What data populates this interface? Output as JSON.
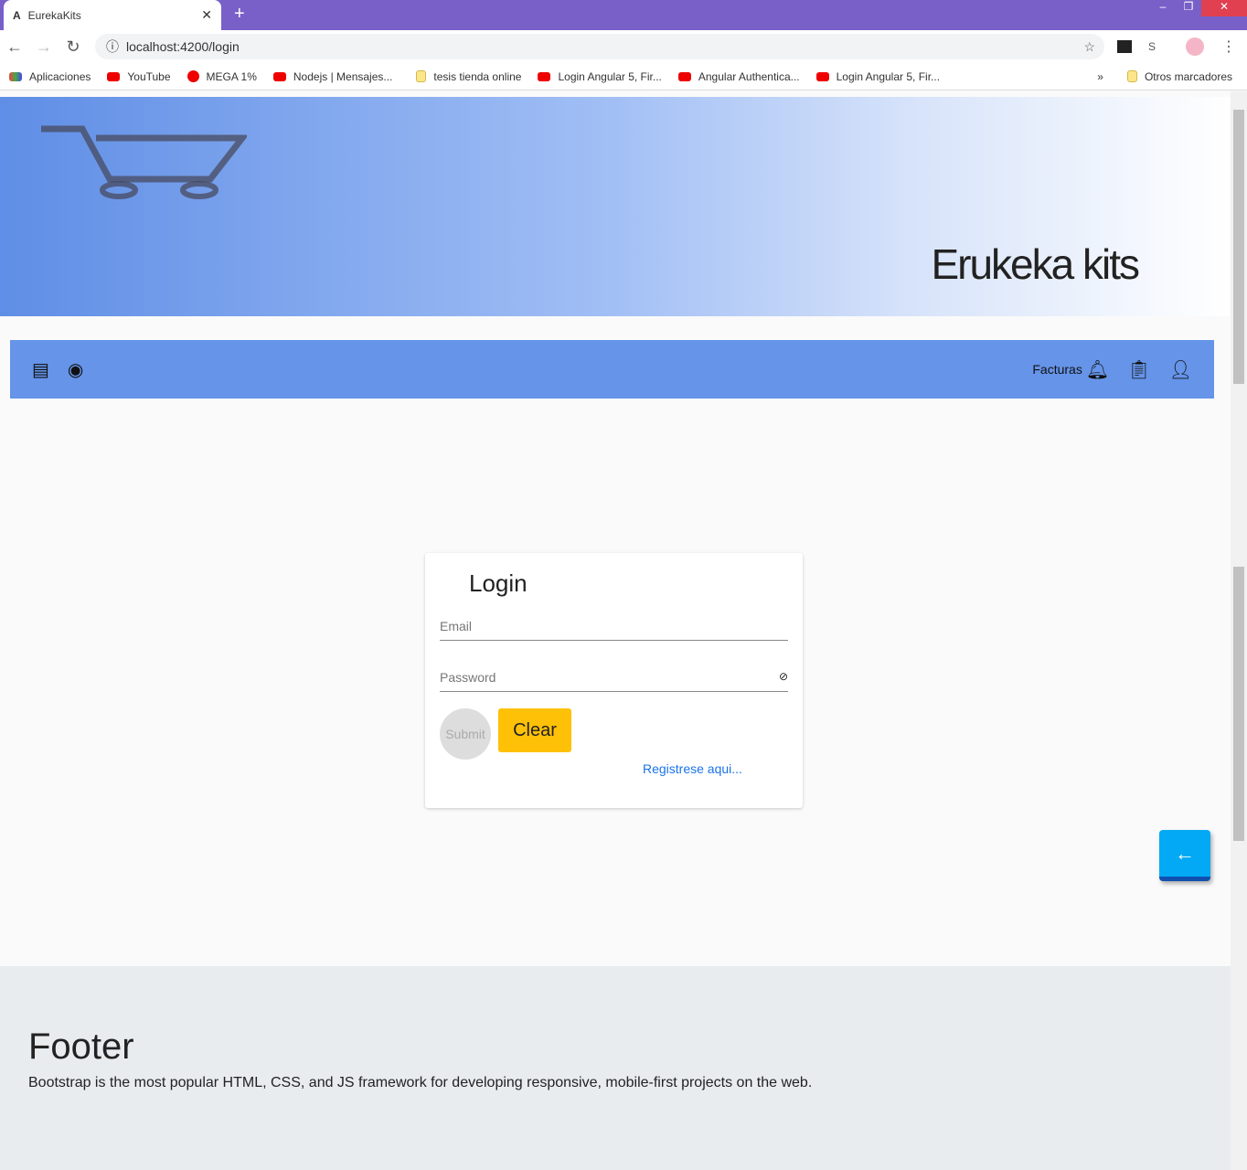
{
  "browser": {
    "tab_title": "EurekaKits",
    "url": "localhost:4200/login",
    "bookmarks": [
      "Aplicaciones",
      "YouTube",
      "MEGA 1%",
      "Nodejs | Mensajes...",
      "tesis tienda online",
      "Login Angular 5, Fir...",
      "Angular Authentica...",
      "Login Angular 5, Fir..."
    ],
    "other_bookmarks": "Otros marcadores"
  },
  "banner": {
    "title": "Erukeka kits"
  },
  "navbar": {
    "facturas": "Facturas"
  },
  "login": {
    "title": "Login",
    "email_placeholder": "Email",
    "password_placeholder": "Password",
    "submit": "Submit",
    "clear": "Clear",
    "register_link": "Registrese aqui..."
  },
  "footer": {
    "title": "Footer",
    "text": "Bootstrap is the most popular HTML, CSS, and JS framework for developing responsive, mobile-first projects on the web."
  },
  "colors": {
    "navbar": "#6594e9",
    "clear": "#ffc107",
    "fab": "#03a9f4",
    "tabbar": "#7860c8"
  }
}
